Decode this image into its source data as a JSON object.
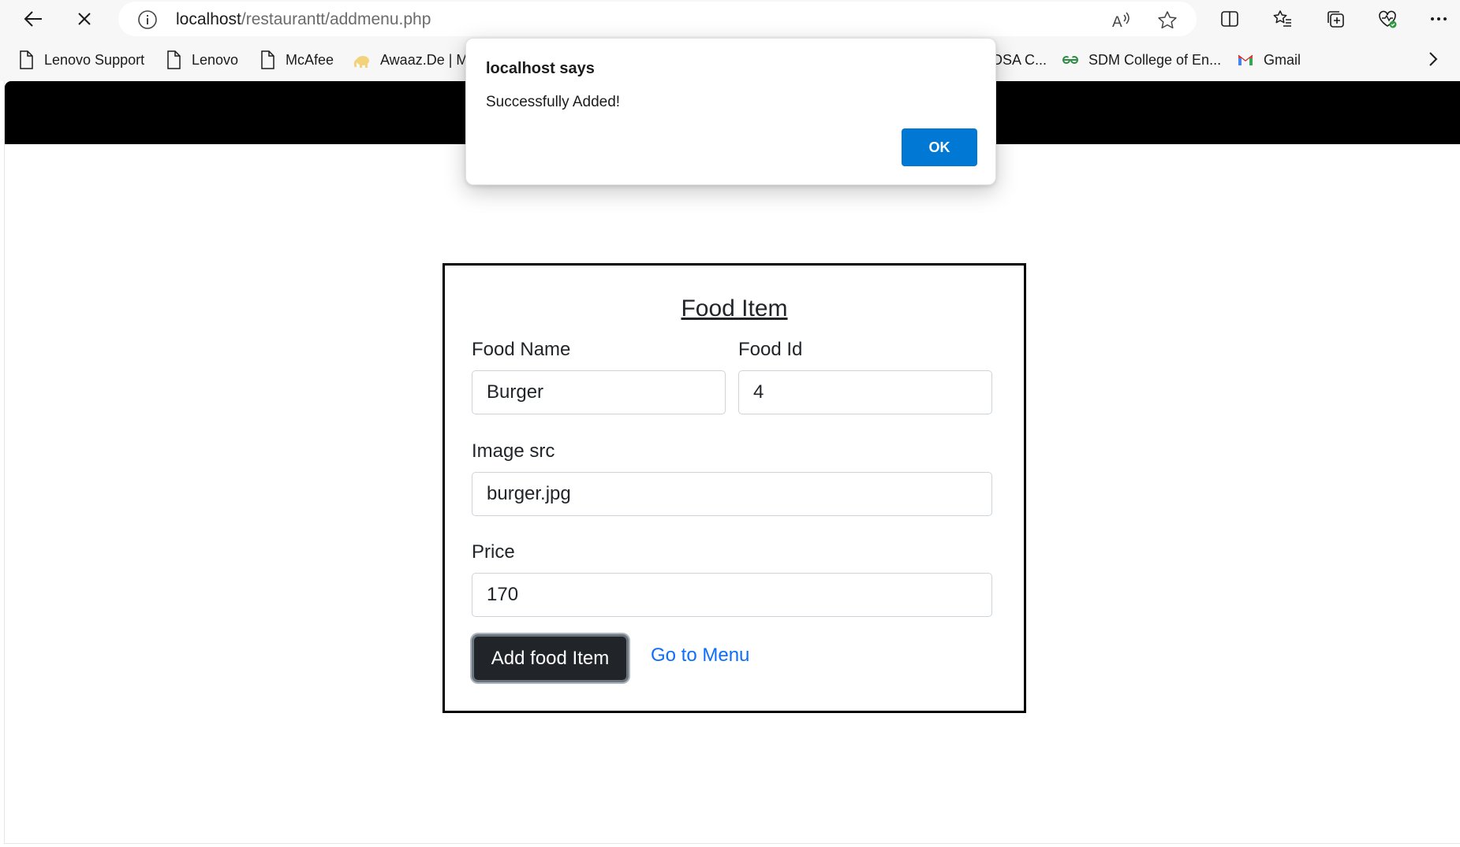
{
  "browser": {
    "url_host": "localhost",
    "url_path": "/restaurantt/addmenu.php",
    "icons": [
      "back-icon",
      "stop-loading-icon",
      "site-info-icon",
      "read-aloud-icon",
      "favorite-star-icon",
      "split-screen-icon",
      "favorites-icon",
      "collections-icon",
      "browser-essentials-icon",
      "more-icon"
    ]
  },
  "bookmarks": [
    {
      "label": "Lenovo Support",
      "icon": "page-icon"
    },
    {
      "label": "Lenovo",
      "icon": "page-icon"
    },
    {
      "label": "McAfee",
      "icon": "page-icon"
    },
    {
      "label": "Awaaz.De | M",
      "icon": "elephant-icon"
    },
    {
      "label": "DSA C...",
      "icon": ""
    },
    {
      "label": "SDM College of En...",
      "icon": "gfg-icon"
    },
    {
      "label": "Gmail",
      "icon": "gmail-icon"
    }
  ],
  "dialog": {
    "title": "localhost says",
    "message": "Successfully Added!",
    "ok_label": "OK"
  },
  "form": {
    "title": "Food Item",
    "food_name_label": "Food Name",
    "food_name_value": "Burger",
    "food_id_label": "Food Id",
    "food_id_value": "4",
    "image_label": "Image src",
    "image_value": "burger.jpg",
    "price_label": "Price",
    "price_value": "170",
    "submit_label": "Add food Item",
    "menu_link_label": "Go to Menu"
  },
  "colors": {
    "header_bg": "#000000",
    "ok_button": "#0078d4",
    "submit_button": "#212529",
    "link": "#0d6efd"
  }
}
